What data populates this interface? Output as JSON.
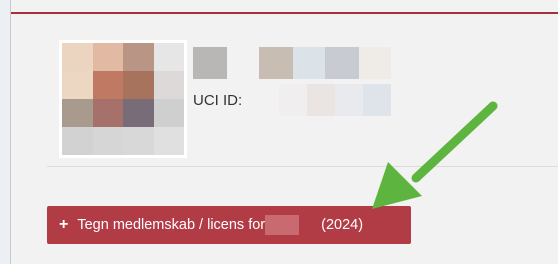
{
  "profile": {
    "photo_tiles": [
      "#ecd5c0",
      "#e2b9a3",
      "#b99585",
      "#e6e6e6",
      "#ecd8c2",
      "#c07a64",
      "#a8735d",
      "#dcd9d8",
      "#a89a8c",
      "#a6706b",
      "#786c79",
      "#cfcfcf",
      "#d2d2d2",
      "#d6d6d6",
      "#d8d8d8",
      "#e0e0e0"
    ],
    "name_tiles": [
      "#b9b6b6",
      "#f2f2f2",
      "#c8bdb3",
      "#dbe3e8",
      "#c8cbd1",
      "#efece8"
    ],
    "uci_label": "UCI ID:",
    "uci_tiles": [
      "#f0eeee",
      "#eae4e3",
      "#e8eaed",
      "#dfe4ea"
    ]
  },
  "actions": {
    "sign_button": {
      "plus": "+",
      "label": "Tegn medlemskab / licens for",
      "year": "(2024)"
    }
  },
  "colors": {
    "accent": "#a6313b",
    "button": "#b23c46",
    "arrow": "#5db540"
  }
}
